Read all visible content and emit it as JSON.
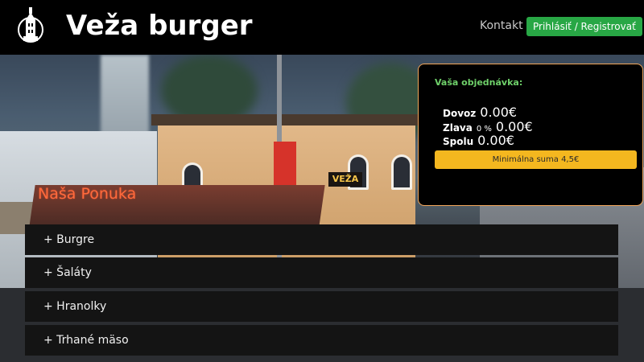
{
  "header": {
    "brand": "Veža burger",
    "nav_contact": "Kontakt",
    "nav_login": "Prihlásiť / Registrovať",
    "logo_icon": "tower-icon"
  },
  "hero": {
    "sign_text": "VEŽA"
  },
  "order": {
    "title": "Vaša objednávka:",
    "delivery_label": "Dovoz",
    "delivery_value": "0.00€",
    "discount_label": "Zlava",
    "discount_percent": "0 %",
    "discount_value": "0.00€",
    "total_label": "Spolu",
    "total_value": "0.00€",
    "min_notice": "Minimálna suma 4,5€"
  },
  "menu": {
    "title": "Naša Ponuka",
    "items": [
      {
        "label": "+ Burgre"
      },
      {
        "label": "+ Šaláty"
      },
      {
        "label": "+ Hranolky"
      },
      {
        "label": "+ Trhané mäso"
      }
    ]
  },
  "colors": {
    "accent_green": "#28a745",
    "order_border": "#f2a65a",
    "order_title": "#6fd16a",
    "min_button": "#f4b71f",
    "menu_title": "#ff6a3c"
  }
}
